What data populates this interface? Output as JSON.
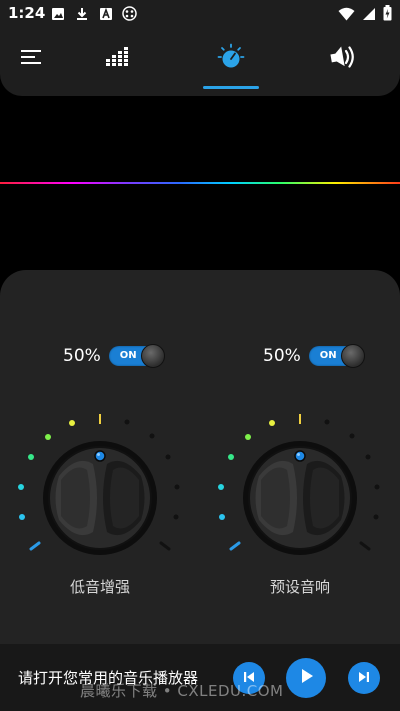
{
  "status_bar": {
    "time": "1:24",
    "icons_left": [
      "image-icon",
      "download-icon",
      "font-icon",
      "network-icon"
    ],
    "icons_right": [
      "wifi-icon",
      "signal-icon",
      "battery-charging-icon"
    ]
  },
  "nav": {
    "tabs": [
      {
        "name": "menu-icon",
        "active": false
      },
      {
        "name": "equalizer-icon",
        "active": false
      },
      {
        "name": "bass-knob-icon",
        "active": true
      },
      {
        "name": "speaker-volume-icon",
        "active": false
      }
    ],
    "accent_color": "#2ba3e8"
  },
  "spectrum": {
    "colors": [
      "#ff1e3c",
      "#ff00ff",
      "#7b3cff",
      "#2b6bff",
      "#00d2ff",
      "#2bff6b",
      "#ffee00",
      "#ff3a1a"
    ]
  },
  "controls": {
    "left": {
      "value": "50%",
      "switch_label": "ON",
      "switch_on": true,
      "knob_label": "低音增强"
    },
    "right": {
      "value": "50%",
      "switch_label": "ON",
      "switch_on": true,
      "knob_label": "预设音响"
    }
  },
  "player": {
    "prompt": "请打开您常用的音乐播放器",
    "prev_icon": "skip-previous-icon",
    "play_icon": "play-icon",
    "next_icon": "skip-next-icon"
  },
  "watermark": "晨曦乐下载 • CXLEDU.COM"
}
